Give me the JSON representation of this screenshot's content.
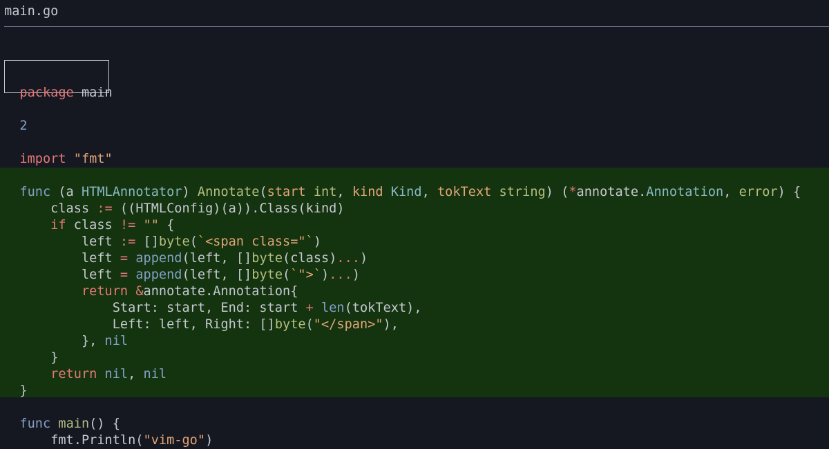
{
  "editor": {
    "filename": "main.go"
  },
  "code": {
    "line_package": [
      "package",
      " main"
    ],
    "line_number_2": "2",
    "line_import": [
      "import",
      " ",
      "\"fmt\""
    ],
    "line_func_sig": [
      "func",
      " (a ",
      "HTMLAnnotator",
      ") ",
      "Annotate",
      "(",
      "start",
      " ",
      "int",
      ", ",
      "kind",
      " ",
      "Kind",
      ", ",
      "tokText",
      " ",
      "string",
      ") (",
      "*",
      "annotate.",
      "Annotation",
      ", ",
      "error",
      ") {"
    ],
    "line_class": [
      "    class ",
      ":=",
      " ((HTMLConfig)(a)).Class(kind)"
    ],
    "line_if": [
      "    ",
      "if",
      " class ",
      "!=",
      " ",
      "\"\"",
      " {"
    ],
    "line_left1": [
      "        left ",
      ":=",
      " []",
      "byte",
      "(",
      "`<span class=\"`",
      ")"
    ],
    "line_left2": [
      "        left ",
      "=",
      " ",
      "append",
      "(left, []",
      "byte",
      "(class)",
      "...",
      ")"
    ],
    "line_left3": [
      "        left ",
      "=",
      " ",
      "append",
      "(left, []",
      "byte",
      "(",
      "`\">`",
      ")",
      "...",
      ")"
    ],
    "line_return_ann": [
      "        ",
      "return",
      " ",
      "&",
      "annotate.Annotation{"
    ],
    "line_start": [
      "            Start: start, End: start ",
      "+",
      " ",
      "len",
      "(tokText),"
    ],
    "line_leftright": [
      "            Left: left, Right: []",
      "byte",
      "(",
      "\"</span>\"",
      "),"
    ],
    "line_nil": [
      "        }, ",
      "nil"
    ],
    "line_close_if": "    }",
    "line_return_nil": [
      "    ",
      "return",
      " ",
      "nil",
      ", ",
      "nil"
    ],
    "line_close_func": "}",
    "line_main": [
      "func",
      " ",
      "main",
      "() {"
    ],
    "line_println": [
      "    fmt.Println(",
      "\"vim-go\"",
      ")"
    ]
  },
  "colors": {
    "background": "#161821",
    "highlight": "#14340f",
    "keyword": "#e27878",
    "function": "#b4be82",
    "type": "#89b8c2",
    "string": "#e2a478",
    "builtin": "#84a0c6",
    "text": "#c6c8d1"
  }
}
